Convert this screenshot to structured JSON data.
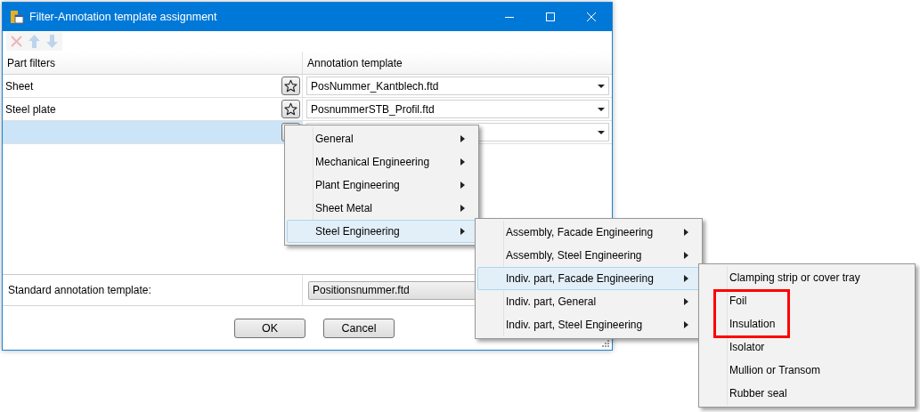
{
  "window": {
    "title": "Filter-Annotation template assignment"
  },
  "toolbar": [
    {
      "kind": "delete",
      "disabled": true
    },
    {
      "kind": "up",
      "disabled": true
    },
    {
      "kind": "down",
      "disabled": true
    }
  ],
  "table": {
    "columns": [
      "Part filters",
      "Annotation template"
    ],
    "rows": [
      {
        "filter": "Sheet",
        "template": "PosNummer_Kantblech.ftd",
        "selected": false
      },
      {
        "filter": "Steel plate",
        "template": "PosnummerSTB_Profil.ftd",
        "selected": false
      },
      {
        "selected": true
      }
    ]
  },
  "standard": {
    "label": "Standard annotation template:",
    "value": "Positionsnummer.ftd"
  },
  "buttons": [
    "OK",
    "Cancel"
  ],
  "menus": [
    {
      "items": [
        {
          "label": "General",
          "submenu": true,
          "selected": false
        },
        {
          "label": "Mechanical Engineering",
          "submenu": true,
          "selected": false
        },
        {
          "label": "Plant Engineering",
          "submenu": true,
          "selected": false
        },
        {
          "label": "Sheet Metal",
          "submenu": true,
          "selected": false
        },
        {
          "label": "Steel Engineering",
          "submenu": true,
          "selected": true
        }
      ]
    },
    {
      "items": [
        {
          "label": "Assembly, Facade Engineering",
          "submenu": true,
          "selected": false
        },
        {
          "label": "Assembly, Steel Engineering",
          "submenu": true,
          "selected": false
        },
        {
          "label": "Indiv. part, Facade Engineering",
          "submenu": true,
          "selected": true
        },
        {
          "label": "Indiv. part, General",
          "submenu": true,
          "selected": false
        },
        {
          "label": "Indiv. part, Steel Engineering",
          "submenu": true,
          "selected": false
        }
      ]
    },
    {
      "items": [
        {
          "label": "Clamping strip or cover tray",
          "submenu": false,
          "selected": false,
          "highlighted": false
        },
        {
          "label": "Foil",
          "submenu": false,
          "selected": false,
          "highlighted": true
        },
        {
          "label": "Insulation",
          "submenu": false,
          "selected": false,
          "highlighted": true
        },
        {
          "label": "Isolator",
          "submenu": false,
          "selected": false,
          "highlighted": false
        },
        {
          "label": "Mullion or Transom",
          "submenu": false,
          "selected": false,
          "highlighted": false
        },
        {
          "label": "Rubber seal",
          "submenu": false,
          "selected": false,
          "highlighted": false
        }
      ]
    }
  ]
}
